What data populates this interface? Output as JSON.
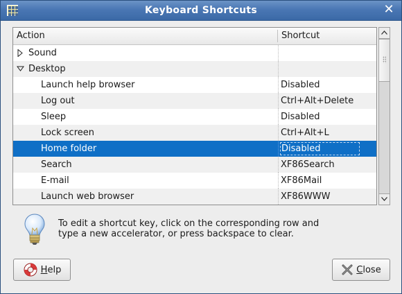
{
  "window": {
    "title": "Keyboard Shortcuts",
    "app_icon": "keyboard-grid-icon",
    "close_glyph": "✕"
  },
  "table": {
    "columns": [
      "Action",
      "Shortcut"
    ],
    "rows": [
      {
        "action": "Sound",
        "shortcut": "",
        "type": "category",
        "expanded": false
      },
      {
        "action": "Desktop",
        "shortcut": "",
        "type": "category",
        "expanded": true
      },
      {
        "action": "Launch help browser",
        "shortcut": "Disabled",
        "type": "item"
      },
      {
        "action": "Log out",
        "shortcut": "Ctrl+Alt+Delete",
        "type": "item"
      },
      {
        "action": "Sleep",
        "shortcut": "Disabled",
        "type": "item"
      },
      {
        "action": "Lock screen",
        "shortcut": "Ctrl+Alt+L",
        "type": "item"
      },
      {
        "action": "Home folder",
        "shortcut": "Disabled",
        "type": "item",
        "selected": true
      },
      {
        "action": "Search",
        "shortcut": "XF86Search",
        "type": "item"
      },
      {
        "action": "E-mail",
        "shortcut": "XF86Mail",
        "type": "item"
      },
      {
        "action": "Launch web browser",
        "shortcut": "XF86WWW",
        "type": "item"
      }
    ]
  },
  "hint": {
    "icon": "lightbulb-icon",
    "text": "To edit a shortcut key, click on the corresponding row and type a new accelerator, or press backspace to clear."
  },
  "buttons": {
    "help": {
      "mnemonic": "H",
      "rest": "elp",
      "icon": "lifebuoy-icon"
    },
    "close": {
      "mnemonic": "C",
      "rest": "lose",
      "icon": "close-x-icon"
    }
  },
  "colors": {
    "titlebar": "#4a77b4",
    "selection": "#0f6fc6",
    "window_bg": "#ededed"
  }
}
